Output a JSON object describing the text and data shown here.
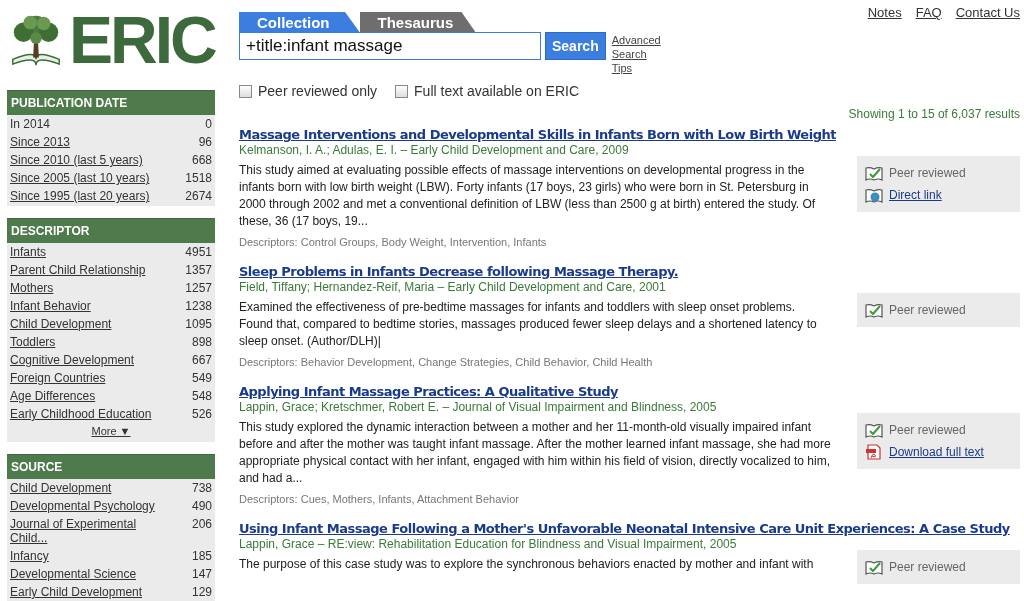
{
  "logo": {
    "text": "ERIC"
  },
  "facets": [
    {
      "title": "PUBLICATION DATE",
      "items": [
        {
          "label": "In 2014",
          "count": "0",
          "linked": false
        },
        {
          "label": "Since 2013",
          "count": "96",
          "linked": true
        },
        {
          "label": "Since 2010 (last 5 years)",
          "count": "668",
          "linked": true
        },
        {
          "label": "Since 2005 (last 10 years)",
          "count": "1518",
          "linked": true
        },
        {
          "label": "Since 1995 (last 20 years)",
          "count": "2674",
          "linked": true
        }
      ]
    },
    {
      "title": "DESCRIPTOR",
      "items": [
        {
          "label": "Infants",
          "count": "4951",
          "linked": true
        },
        {
          "label": "Parent Child Relationship",
          "count": "1357",
          "linked": true
        },
        {
          "label": "Mothers",
          "count": "1257",
          "linked": true
        },
        {
          "label": "Infant Behavior",
          "count": "1238",
          "linked": true
        },
        {
          "label": "Child Development",
          "count": "1095",
          "linked": true
        },
        {
          "label": "Toddlers",
          "count": "898",
          "linked": true
        },
        {
          "label": "Cognitive Development",
          "count": "667",
          "linked": true
        },
        {
          "label": "Foreign Countries",
          "count": "549",
          "linked": true
        },
        {
          "label": "Age Differences",
          "count": "548",
          "linked": true
        },
        {
          "label": "Early Childhood Education",
          "count": "526",
          "linked": true
        }
      ],
      "more": "More ▼"
    },
    {
      "title": "SOURCE",
      "items": [
        {
          "label": "Child Development",
          "count": "738",
          "linked": true
        },
        {
          "label": "Developmental Psychology",
          "count": "490",
          "linked": true
        },
        {
          "label": "Journal of Experimental Child...",
          "count": "206",
          "linked": true
        },
        {
          "label": "Infancy",
          "count": "185",
          "linked": true
        },
        {
          "label": "Developmental Science",
          "count": "147",
          "linked": true
        },
        {
          "label": "Early Child Development",
          "count": "129",
          "linked": true
        }
      ]
    }
  ],
  "tabs": [
    {
      "label": "Collection",
      "selected": true
    },
    {
      "label": "Thesaurus",
      "selected": false
    }
  ],
  "search": {
    "value": "+title:infant massage",
    "button": "Search",
    "tips": "Advanced Search Tips"
  },
  "filters": [
    {
      "label": "Peer reviewed only",
      "checked": false
    },
    {
      "label": "Full text available on ERIC",
      "checked": false
    }
  ],
  "top_links": [
    "Notes",
    "FAQ",
    "Contact Us"
  ],
  "results_count": "Showing 1 to 15 of 6,037 results",
  "results": [
    {
      "title": "Massage Interventions and Developmental Skills in Infants Born with Low Birth Weight",
      "source": "Kelmanson, I. A.; Adulas, E. I. – Early Child Development and Care, 2009",
      "abstract": "This study aimed at evaluating possible effects of massage interventions on developmental progress in the infants born with low birth weight (LBW). Forty infants (17 boys, 23 girls) who were born in St. Petersburg in 2000 through 2002 and met a conventional definition of LBW (less than 2500 g at birth) entered the study. Of these, 36 (17 boys, 19...",
      "descriptors": "Descriptors: Control Groups, Body Weight, Intervention, Infants",
      "badges": [
        {
          "kind": "peer",
          "label": "Peer reviewed"
        },
        {
          "kind": "link",
          "label": "Direct link"
        }
      ]
    },
    {
      "title": "Sleep Problems in Infants Decrease following Massage Therapy.",
      "source": "Field, Tiffany; Hernandez-Reif, Maria – Early Child Development and Care, 2001",
      "abstract": "Examined the effectiveness of pre-bedtime massages for infants and toddlers with sleep onset problems. Found that, compared to bedtime stories, massages produced fewer sleep delays and a shortened latency to sleep onset. (Author/DLH)|",
      "descriptors": "Descriptors: Behavior Development, Change Strategies, Child Behavior, Child Health",
      "badges": [
        {
          "kind": "peer",
          "label": "Peer reviewed"
        }
      ]
    },
    {
      "title": "Applying Infant Massage Practices: A Qualitative Study",
      "source": "Lappin, Grace; Kretschmer, Robert E. – Journal of Visual Impairment and Blindness, 2005",
      "abstract": "This study explored the dynamic interaction between a mother and her 11-month-old visually impaired infant before and after the mother was taught infant massage. After the mother learned infant massage, she had more appropriate physical contact with her infant, engaged with him within his field of vision, directly vocalized to him, and had a...",
      "descriptors": "Descriptors: Cues, Mothers, Infants, Attachment Behavior",
      "badges": [
        {
          "kind": "peer",
          "label": "Peer reviewed"
        },
        {
          "kind": "pdf",
          "label": "Download full text"
        }
      ]
    },
    {
      "title": "Using Infant Massage Following a Mother's Unfavorable Neonatal Intensive Care Unit Experiences: A Case Study",
      "source": "Lappin, Grace – RE:view: Rehabilitation Education for Blindness and Visual Impairment, 2005",
      "abstract": "The purpose of this case study was to explore the synchronous behaviors enacted by mother and infant with",
      "badges": [
        {
          "kind": "peer",
          "label": "Peer reviewed"
        }
      ]
    }
  ]
}
